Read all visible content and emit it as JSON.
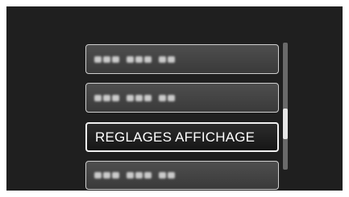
{
  "menu": {
    "items": [
      {
        "label": "",
        "blurred": true
      },
      {
        "label": "",
        "blurred": true
      },
      {
        "label": "REGLAGES AFFICHAGE",
        "blurred": false,
        "selected": true
      },
      {
        "label": "",
        "blurred": true
      }
    ]
  },
  "colors": {
    "screen_background": "#1f1f1f",
    "item_background": "#454545",
    "item_border": "#cfcfcf",
    "selected_text": "#ffffff"
  }
}
